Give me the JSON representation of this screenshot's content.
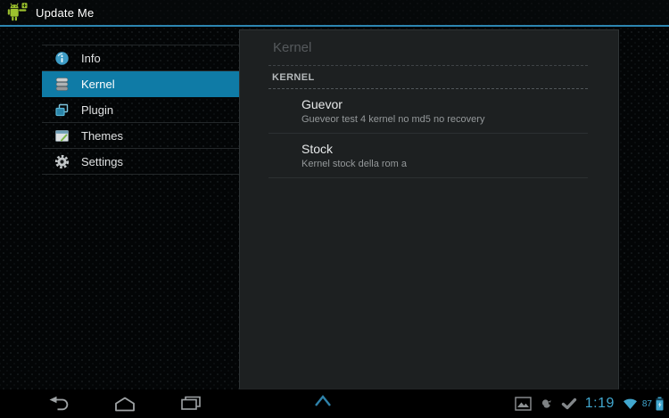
{
  "app": {
    "title": "Update Me",
    "icon": "android-robot-update-icon"
  },
  "colors": {
    "accent_blue": "#33b5e5",
    "selected_item_bg": "#0f7ba6",
    "actionbar_underline": "#2d86b1",
    "panel_bg": "#1d2021",
    "status_blue": "#41a7cf",
    "icon_gray": "#9fa3a5"
  },
  "sidebar": {
    "items": [
      {
        "label": "Info",
        "icon": "info-icon",
        "selected": false
      },
      {
        "label": "Kernel",
        "icon": "database-icon",
        "selected": true
      },
      {
        "label": "Plugin",
        "icon": "plugin-icon",
        "selected": false
      },
      {
        "label": "Themes",
        "icon": "themes-icon",
        "selected": false
      },
      {
        "label": "Settings",
        "icon": "gear-icon",
        "selected": false
      }
    ]
  },
  "panel": {
    "breadcrumb": "Kernel",
    "section_header": "KERNEL",
    "items": [
      {
        "title": "Guevor",
        "subtitle": "Gueveor test 4 kernel no md5 no recovery"
      },
      {
        "title": "Stock",
        "subtitle": "Kernel stock della rom a"
      }
    ]
  },
  "navbar": {
    "buttons": [
      "back",
      "home",
      "recent-apps"
    ],
    "center": "menu-caret-up",
    "status": {
      "notification_icons": [
        "screenshot-icon",
        "notification-bird-icon",
        "check-icon"
      ],
      "time": "1:19",
      "wifi": "wifi-full",
      "battery_percent": "87",
      "battery": "battery-charging"
    }
  }
}
